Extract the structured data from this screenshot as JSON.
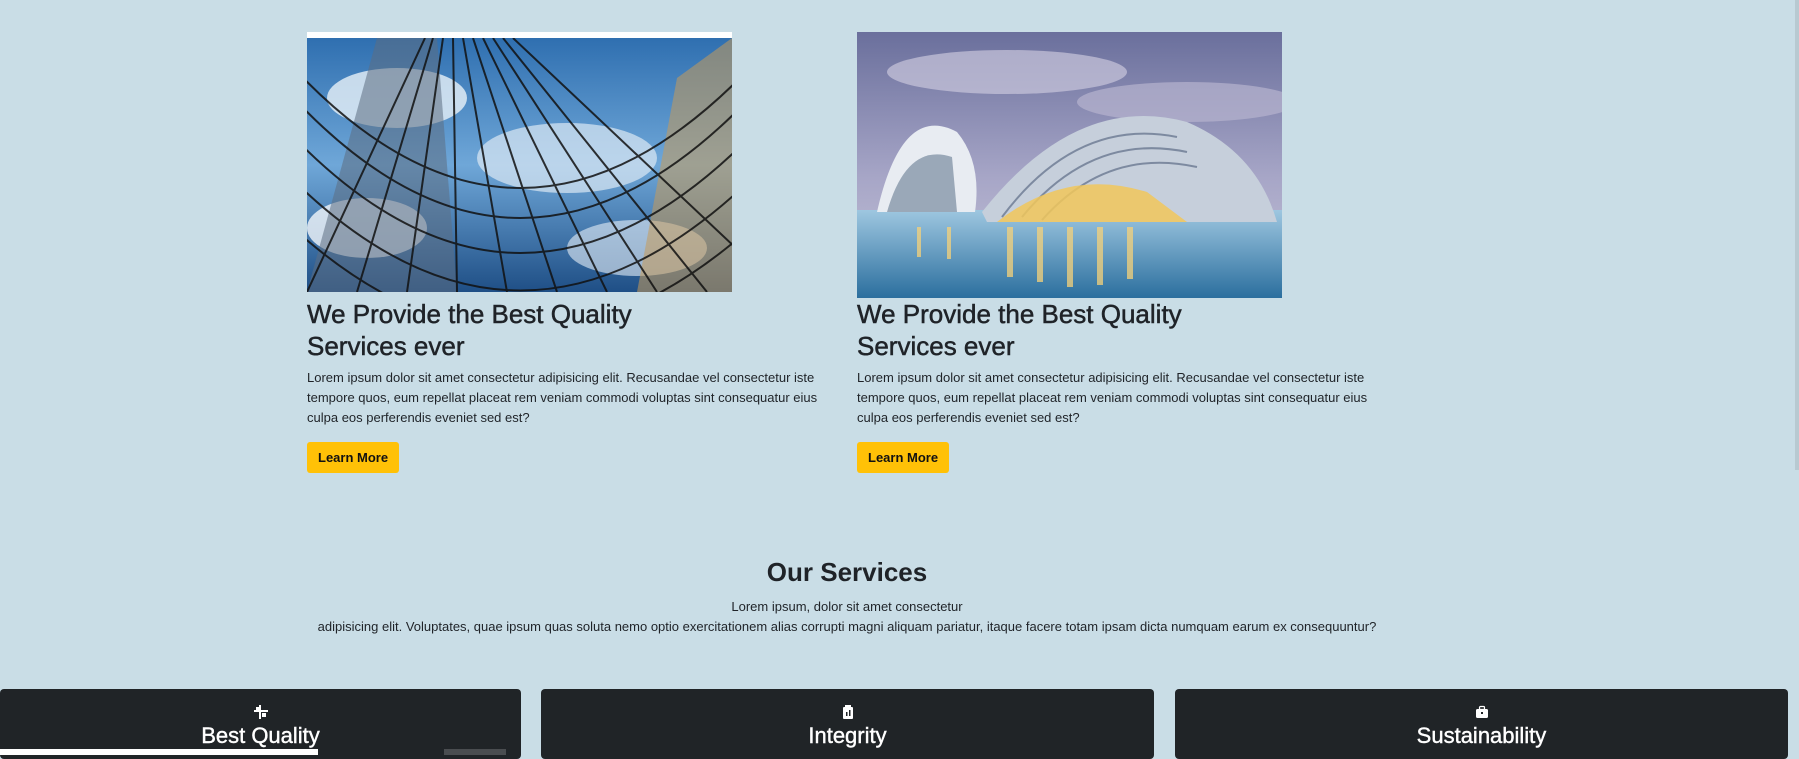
{
  "cards": [
    {
      "image": "glass-skyscraper-photo",
      "title_line1": "We Provide the Best Quality",
      "title_line2": "Services ever",
      "body": "Lorem ipsum dolor sit amet consectetur adipisicing elit. Recusandae vel consectetur iste tempore quos, eum repellat placeat rem veniam commodi voluptas sint consequatur eius culpa eos perferendis eveniet sed est?",
      "button": "Learn More"
    },
    {
      "image": "city-of-arts-and-sciences-photo",
      "title_line1": "We Provide the Best Quality",
      "title_line2": "Services ever",
      "body": "Lorem ipsum dolor sit amet consectetur adipisicing elit. Recusandae vel consectetur iste tempore quos, eum repellat placeat rem veniam commodi voluptas sint consequatur eius culpa eos perferendis eveniet sed est?",
      "button": "Learn More"
    }
  ],
  "services": {
    "title": "Our Services",
    "subtitle_line1": "Lorem ipsum, dolor sit amet consectetur",
    "subtitle_line2": "adipisicing elit. Voluptates, quae ipsum quas soluta nemo optio exercitationem alias corrupti magni aliquam pariatur, itaque facere totam ipsam dicta numquam earum ex consequuntur?"
  },
  "features": [
    {
      "icon": "slack-icon",
      "title": "Best Quality"
    },
    {
      "icon": "clipboard-icon",
      "title": "Integrity"
    },
    {
      "icon": "briefcase-icon",
      "title": "Sustainability"
    }
  ],
  "colors": {
    "background": "#c9dde6",
    "button": "#ffc107",
    "feature_card": "#202427"
  }
}
